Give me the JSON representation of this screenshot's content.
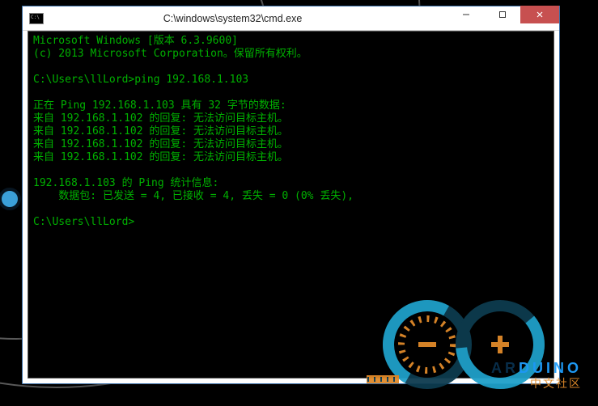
{
  "window": {
    "title": "C:\\windows\\system32\\cmd.exe",
    "controls": {
      "minimize": "–",
      "maximize": "▢",
      "close": "✕"
    }
  },
  "terminal": {
    "lines": [
      "Microsoft Windows [版本 6.3.9600]",
      "(c) 2013 Microsoft Corporation。保留所有权利。",
      "",
      "C:\\Users\\llLord>ping 192.168.1.103",
      "",
      "正在 Ping 192.168.1.103 具有 32 字节的数据:",
      "来自 192.168.1.102 的回复: 无法访问目标主机。",
      "来自 192.168.1.102 的回复: 无法访问目标主机。",
      "来自 192.168.1.102 的回复: 无法访问目标主机。",
      "来自 192.168.1.102 的回复: 无法访问目标主机。",
      "",
      "192.168.1.103 的 Ping 统计信息:",
      "    数据包: 已发送 = 4, 已接收 = 4, 丢失 = 0 (0% 丢失),",
      "",
      "C:\\Users\\llLord>"
    ]
  },
  "watermark": {
    "brand": "ARDUINO",
    "subtitle": "中文社区"
  }
}
